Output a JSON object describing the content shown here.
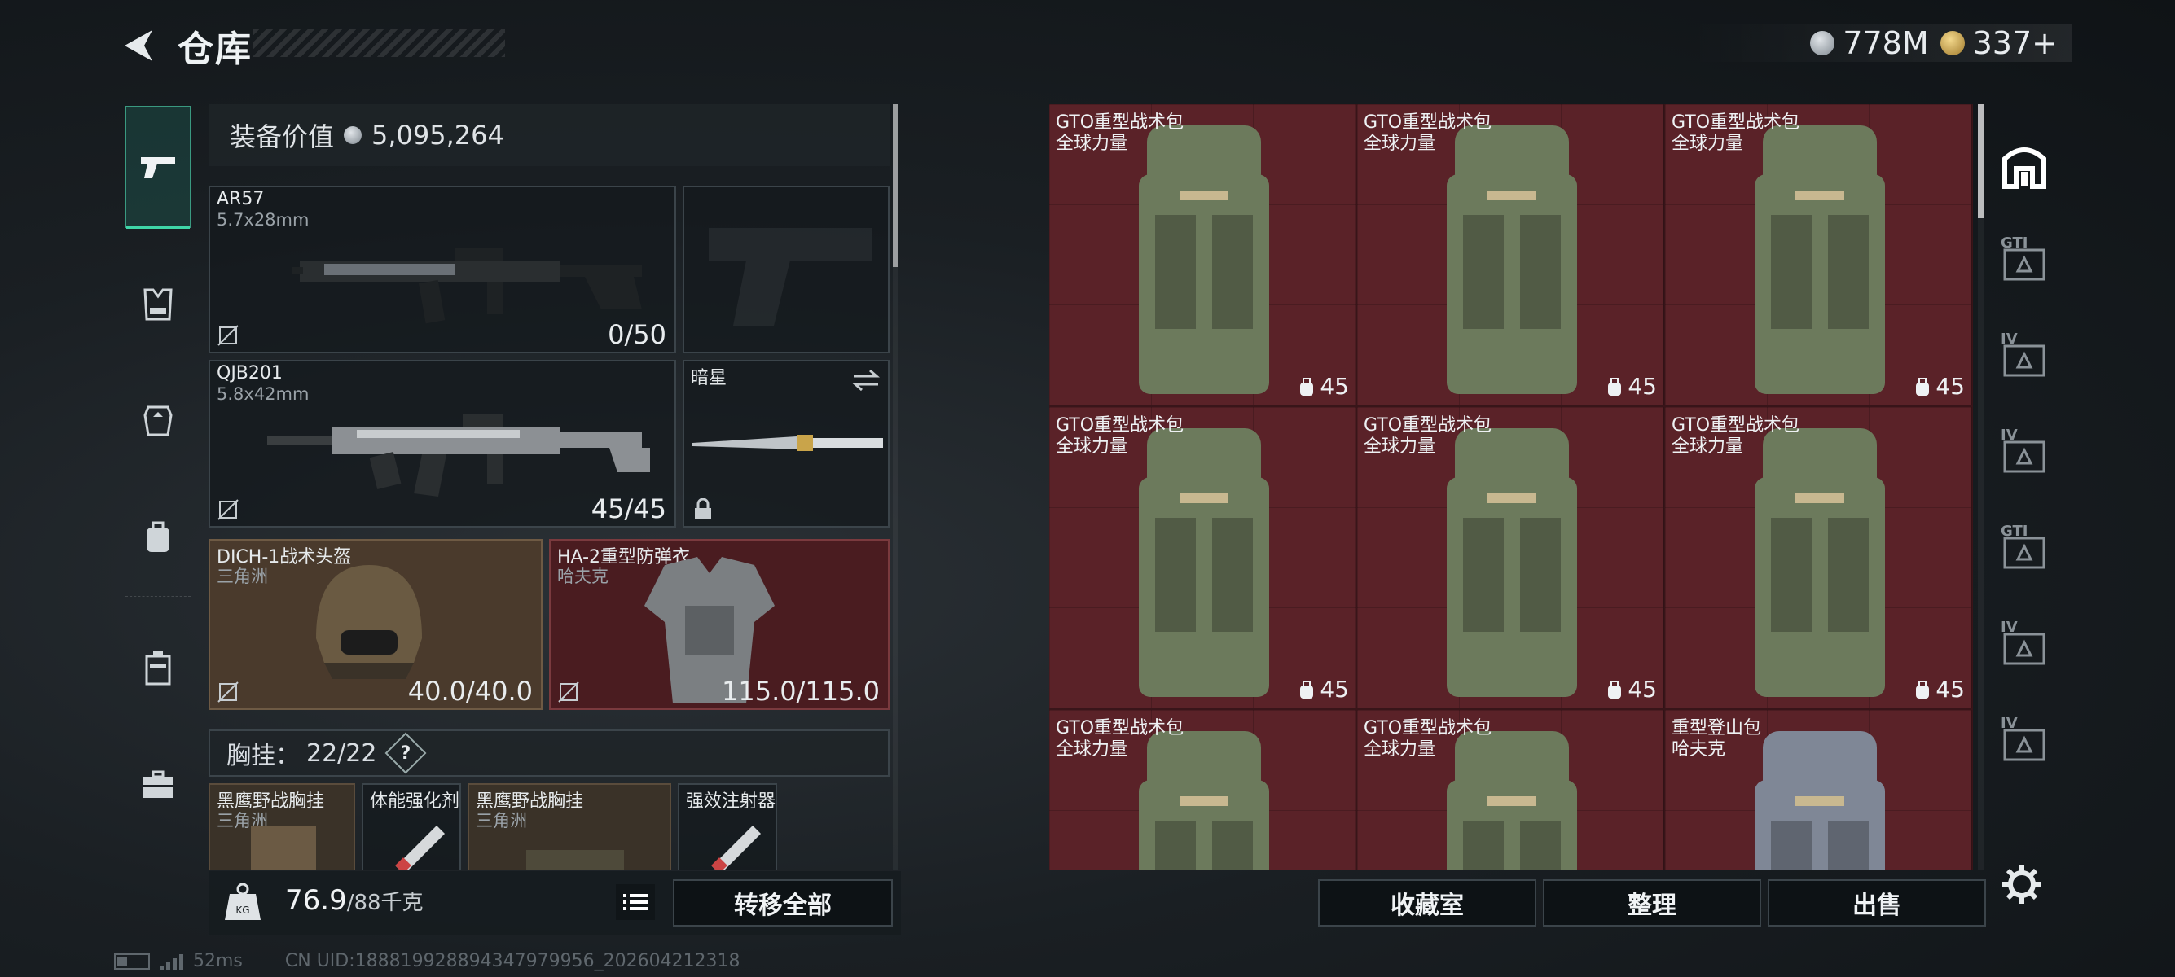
{
  "header": {
    "title": "仓库",
    "currency": [
      {
        "icon": "silver-coin-icon",
        "value": "778M"
      },
      {
        "icon": "gold-coin-icon",
        "value": "337+"
      }
    ]
  },
  "nav": {
    "items": [
      {
        "name": "weapons",
        "icon": "pistol-icon",
        "active": true
      },
      {
        "name": "vest",
        "icon": "vest-icon"
      },
      {
        "name": "armor",
        "icon": "armor-icon"
      },
      {
        "name": "backpack",
        "icon": "backpack-icon"
      },
      {
        "name": "container",
        "icon": "container-icon"
      },
      {
        "name": "medkit",
        "icon": "medkit-icon"
      }
    ]
  },
  "equipment": {
    "value_label": "装备价值",
    "value": "5,095,264",
    "primary": {
      "name": "AR57",
      "caliber": "5.7x28mm",
      "ammo": "0/50"
    },
    "secondary": {
      "name": "QJB201",
      "caliber": "5.8x42mm",
      "ammo": "45/45"
    },
    "melee": {
      "name": "暗星"
    },
    "helmet": {
      "name": "DICH-1战术头盔",
      "sub": "三角洲",
      "durability": "40.0/40.0"
    },
    "armor": {
      "name": "HA-2重型防弹衣",
      "sub": "哈夫克",
      "durability": "115.0/115.0"
    },
    "vest_bar": {
      "label": "胸挂：",
      "capacity": "22/22",
      "help": "?"
    },
    "vest_items": [
      {
        "name": "黑鹰野战胸挂",
        "sub": "三角洲"
      },
      {
        "name": "体能强化剂",
        "sub": ""
      },
      {
        "name": "黑鹰野战胸挂",
        "sub": "三角洲"
      },
      {
        "name": "强效注射器",
        "sub": ""
      }
    ]
  },
  "weight": {
    "current": "76.9",
    "max": "/88千克"
  },
  "transfer_all": "转移全部",
  "status": {
    "ping": "52ms",
    "uid": "CN UID:188819928894347979956_202604212318"
  },
  "storage": {
    "cells": [
      {
        "name": "GTO重型战术包",
        "sub": "全球力量",
        "durability": "45",
        "color": "#6c7a5c"
      },
      {
        "name": "GTO重型战术包",
        "sub": "全球力量",
        "durability": "45",
        "color": "#6c7a5c"
      },
      {
        "name": "GTO重型战术包",
        "sub": "全球力量",
        "durability": "45",
        "color": "#6c7a5c"
      },
      {
        "name": "GTO重型战术包",
        "sub": "全球力量",
        "durability": "45",
        "color": "#6c7a5c"
      },
      {
        "name": "GTO重型战术包",
        "sub": "全球力量",
        "durability": "45",
        "color": "#6c7a5c"
      },
      {
        "name": "GTO重型战术包",
        "sub": "全球力量",
        "durability": "45",
        "color": "#6c7a5c"
      },
      {
        "name": "GTO重型战术包",
        "sub": "全球力量",
        "durability": "",
        "color": "#6c7a5c"
      },
      {
        "name": "GTO重型战术包",
        "sub": "全球力量",
        "durability": "",
        "color": "#6c7a5c"
      },
      {
        "name": "重型登山包",
        "sub": "哈夫克",
        "durability": "",
        "color": "#7f8796"
      }
    ],
    "buttons": [
      "收藏室",
      "整理",
      "出售"
    ]
  },
  "right_nav": {
    "items": [
      {
        "icon": "storage-home-icon",
        "label": ""
      },
      {
        "icon": "storage-tab-icon",
        "label": "GTI"
      },
      {
        "icon": "storage-tab-icon",
        "label": "IV"
      },
      {
        "icon": "storage-tab-icon",
        "label": "IV"
      },
      {
        "icon": "storage-tab-icon",
        "label": "GTI"
      },
      {
        "icon": "storage-tab-icon",
        "label": "IV"
      },
      {
        "icon": "storage-tab-icon",
        "label": "IV"
      }
    ]
  }
}
